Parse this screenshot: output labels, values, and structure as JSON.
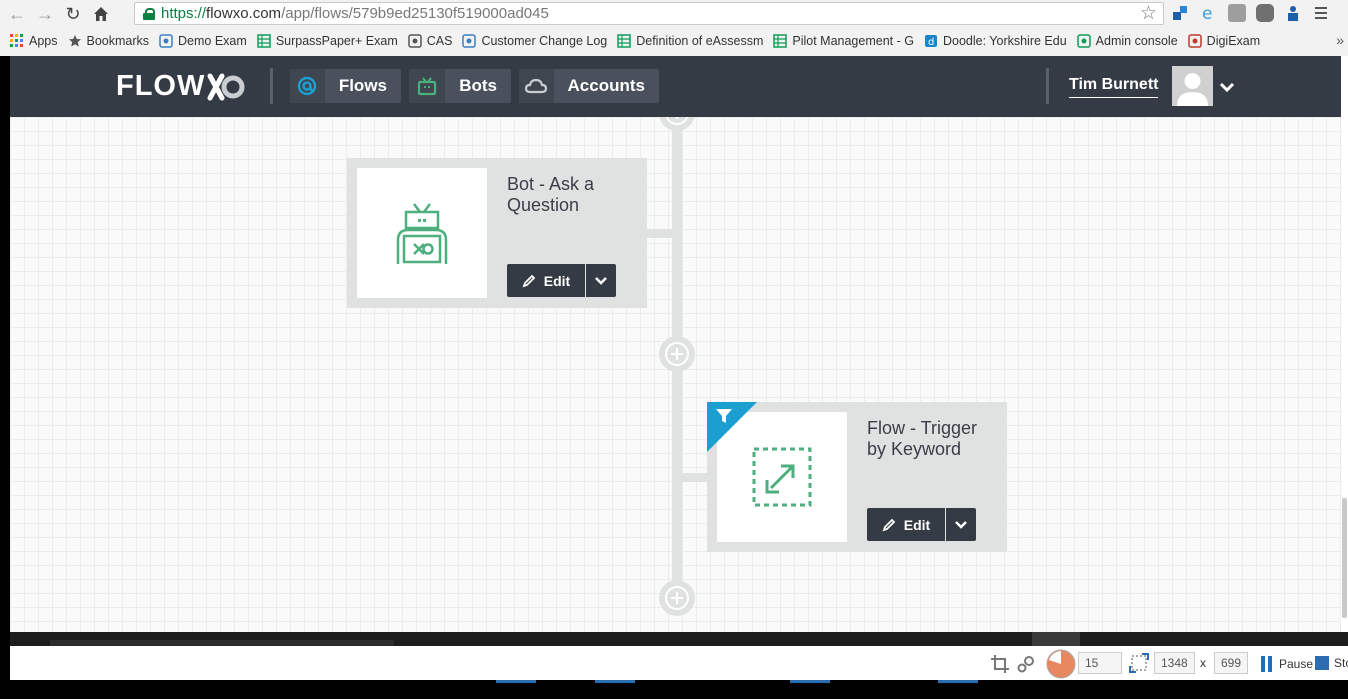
{
  "browser": {
    "url_scheme": "https://",
    "url_host": "flowxo.com",
    "url_path": "/app/flows/579b9ed25130f519000ad045"
  },
  "bookmarks": [
    {
      "label": "Apps",
      "icon": "apps-grid-icon",
      "color": "#e8453c"
    },
    {
      "label": "Bookmarks",
      "icon": "star-icon",
      "color": "#555555"
    },
    {
      "label": "Demo Exam",
      "icon": "exam-icon",
      "color": "#3a7fc1"
    },
    {
      "label": "SurpassPaper+ Exam",
      "icon": "sheet-icon",
      "color": "#0f9d58"
    },
    {
      "label": "CAS",
      "icon": "cas-icon",
      "color": "#555555"
    },
    {
      "label": "Customer Change Log",
      "icon": "exam-icon",
      "color": "#3a7fc1"
    },
    {
      "label": "Definition of eAssessm",
      "icon": "sheet-icon",
      "color": "#0f9d58"
    },
    {
      "label": "Pilot Management - G",
      "icon": "sheet-icon",
      "color": "#0f9d58"
    },
    {
      "label": "Doodle: Yorkshire Edu",
      "icon": "doodle-icon",
      "color": "#1a86c8"
    },
    {
      "label": "Admin console",
      "icon": "admin-icon",
      "color": "#0f9d58"
    },
    {
      "label": "DigiExam",
      "icon": "digiexam-icon",
      "color": "#c0392b"
    }
  ],
  "bookmarks_more": "»",
  "app": {
    "logo_text": "FLOW",
    "nav": {
      "flows": "Flows",
      "bots": "Bots",
      "accounts": "Accounts"
    },
    "user_name": "Tim Burnett",
    "colors": {
      "header_bg": "#353b45",
      "accent_blue": "#1a9fd0",
      "accent_green": "#4caf7d"
    }
  },
  "cards": [
    {
      "title": "Bot - Ask a Question",
      "icon": "robot-icon",
      "edit_label": "Edit",
      "filtered": false
    },
    {
      "title": "Flow - Trigger by Keyword",
      "icon": "trigger-arrows-icon",
      "edit_label": "Edit",
      "filtered": true
    }
  ],
  "bottom_bar": {
    "fps_value": "15",
    "width_value": "1348",
    "times": "x",
    "height_value": "699",
    "pause_label": "Pause",
    "stop_label": "Sto"
  }
}
